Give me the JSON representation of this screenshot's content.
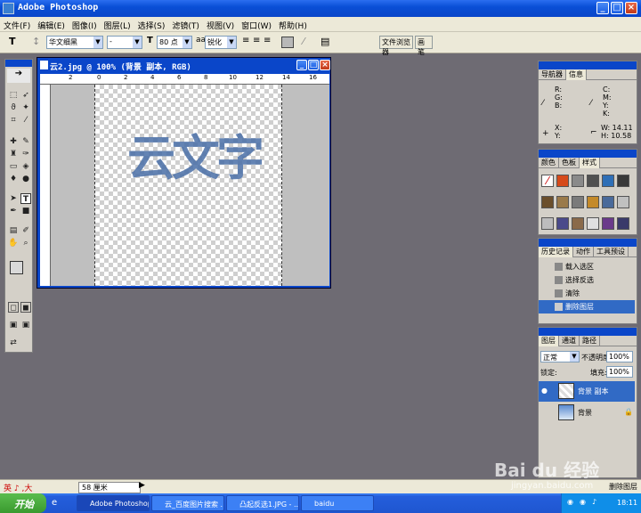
{
  "window": {
    "title": "Adobe Photoshop",
    "buttons": [
      "_",
      "□",
      "×"
    ]
  },
  "menu": [
    "文件(F)",
    "编辑(E)",
    "图像(I)",
    "图层(L)",
    "选择(S)",
    "滤镜(T)",
    "视图(V)",
    "窗口(W)",
    "帮助(H)"
  ],
  "options": {
    "font_family": "华文细黑",
    "font_style": "-",
    "font_size": "80 点",
    "aa": "锐化",
    "tab_browser": "文件浏览器",
    "tab_brush": "画笔"
  },
  "document": {
    "title": "云2.jpg @ 100% (背景 副本, RGB)",
    "ruler_labels": [
      "2",
      "0",
      "2",
      "4",
      "6",
      "8",
      "10",
      "12",
      "14",
      "16"
    ],
    "art_text": "云文字"
  },
  "panels": {
    "navigator": {
      "tabs": [
        "导航器",
        "信息"
      ],
      "rgb": [
        "R:",
        "G:",
        "B:"
      ],
      "cmyk": [
        "C:",
        "M:",
        "Y:",
        "K:"
      ],
      "xy": [
        "X:",
        "Y:"
      ],
      "wh": [
        "W: 14.11",
        "H: 10.58"
      ]
    },
    "color": {
      "tabs": [
        "颜色",
        "色板",
        "样式"
      ]
    },
    "history": {
      "tabs": [
        "历史记录",
        "动作",
        "工具预设"
      ],
      "items": [
        "载入选区",
        "选择反选",
        "清除",
        "删除图层"
      ]
    },
    "layers": {
      "tabs": [
        "图层",
        "通道",
        "路径"
      ],
      "mode": "正常",
      "opacity_label": "不透明度:",
      "opacity": "100%",
      "lock_label": "锁定:",
      "fill_label": "填充:",
      "fill": "100%",
      "items": [
        "背景 副本",
        "背景"
      ]
    }
  },
  "status": {
    "zoom": "58 厘米",
    "ime": "英",
    "ime2": "大",
    "right_label": "删除图层"
  },
  "taskbar": {
    "start": "开始",
    "tasks": [
      "Adobe Photoshop",
      "云_百度图片搜索 ...",
      "凸起反选1.JPG - ...",
      "baidu"
    ],
    "clock": "18:11"
  },
  "watermark": {
    "text": "Bai du 经验",
    "url": "jingyan.baidu.com"
  }
}
